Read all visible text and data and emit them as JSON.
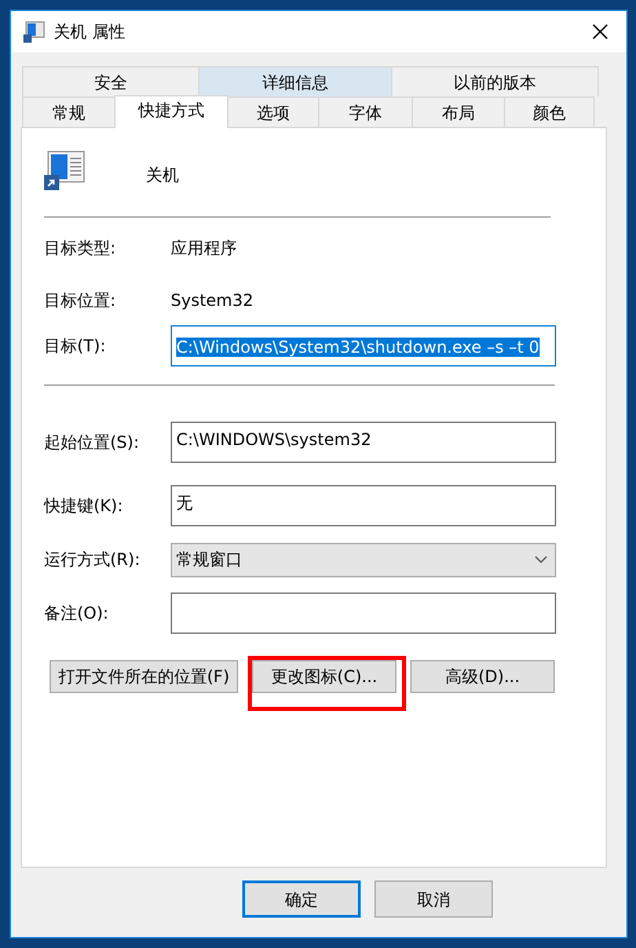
{
  "window": {
    "title": "关机 属性"
  },
  "tabs_back": [
    {
      "label": "安全",
      "selected": false,
      "hovered": false
    },
    {
      "label": "详细信息",
      "selected": false,
      "hovered": true
    },
    {
      "label": "以前的版本",
      "selected": false,
      "hovered": false
    }
  ],
  "tabs_front": [
    {
      "label": "常规",
      "selected": false
    },
    {
      "label": "快捷方式",
      "selected": true
    },
    {
      "label": "选项",
      "selected": false
    },
    {
      "label": "字体",
      "selected": false
    },
    {
      "label": "布局",
      "selected": false
    },
    {
      "label": "颜色",
      "selected": false
    }
  ],
  "shortcut_name": "关机",
  "info": [
    {
      "label": "目标类型:",
      "value": "应用程序"
    },
    {
      "label": "目标位置:",
      "value": "System32"
    }
  ],
  "target": {
    "label": "目标(T):",
    "value": "C:\\Windows\\System32\\shutdown.exe –s –t 0",
    "text_selected": true
  },
  "fields": [
    {
      "kind": "text",
      "label": "起始位置(S):",
      "value": "C:\\WINDOWS\\system32"
    },
    {
      "kind": "text",
      "label": "快捷键(K):",
      "value": "无"
    },
    {
      "kind": "select",
      "label": "运行方式(R):",
      "value": "常规窗口"
    },
    {
      "kind": "text",
      "label": "备注(O):"
    }
  ],
  "action_buttons": [
    {
      "label": "打开文件所在的位置(F)",
      "highlighted": false
    },
    {
      "label": "更改图标(C)...",
      "highlighted": true
    },
    {
      "label": "高级(D)...",
      "highlighted": false
    }
  ],
  "dialog_buttons": [
    {
      "label": "确定",
      "default": true
    },
    {
      "label": "取消",
      "default": false
    }
  ]
}
